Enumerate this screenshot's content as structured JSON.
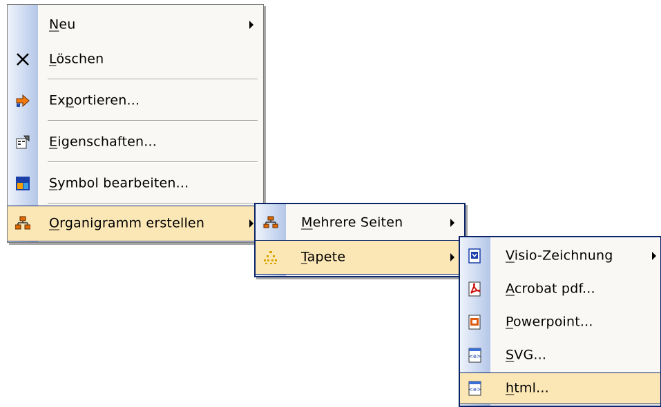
{
  "menu1": {
    "items": [
      {
        "prefix": "",
        "key": "N",
        "rest": "eu",
        "icon": "none",
        "submenu": true
      },
      {
        "prefix": "",
        "key": "L",
        "rest": "öschen",
        "icon": "delete-x-icon",
        "submenu": false
      },
      {
        "prefix": "Ex",
        "key": "p",
        "rest": "ortieren...",
        "icon": "export-arrow-icon",
        "submenu": false
      },
      {
        "prefix": "",
        "key": "E",
        "rest": "igenschaften...",
        "icon": "properties-icon",
        "submenu": false
      },
      {
        "prefix": "",
        "key": "S",
        "rest": "ymbol bearbeiten...",
        "icon": "symbol-edit-icon",
        "submenu": false
      },
      {
        "prefix": "",
        "key": "O",
        "rest": "rganigramm erstellen",
        "icon": "org-chart-icon",
        "submenu": true,
        "highlighted": true
      }
    ]
  },
  "menu2": {
    "items": [
      {
        "prefix": "",
        "key": "M",
        "rest": "ehrere Seiten",
        "icon": "org-chart-small-icon",
        "submenu": true
      },
      {
        "prefix": "",
        "key": "T",
        "rest": "apete",
        "icon": "wallpaper-icon",
        "submenu": true,
        "highlighted": true
      }
    ]
  },
  "menu3": {
    "items": [
      {
        "prefix": "",
        "key": "V",
        "rest": "isio-Zeichnung",
        "icon": "visio-icon",
        "submenu": true
      },
      {
        "prefix": "",
        "key": "A",
        "rest": "crobat pdf...",
        "icon": "acrobat-pdf-icon",
        "submenu": false
      },
      {
        "prefix": "",
        "key": "P",
        "rest": "owerpoint...",
        "icon": "powerpoint-icon",
        "submenu": false
      },
      {
        "prefix": "",
        "key": "S",
        "rest": "VG...",
        "icon": "svg-document-icon",
        "submenu": false
      },
      {
        "prefix": "",
        "key": "h",
        "rest": "tml...",
        "icon": "html-document-icon",
        "submenu": false,
        "highlighted": true
      }
    ]
  },
  "colors": {
    "highlight": "#fbe7b5",
    "highlight_border": "#0a246a",
    "menu_bg": "#f9f8f4",
    "gutter": "#c5d4ee"
  }
}
